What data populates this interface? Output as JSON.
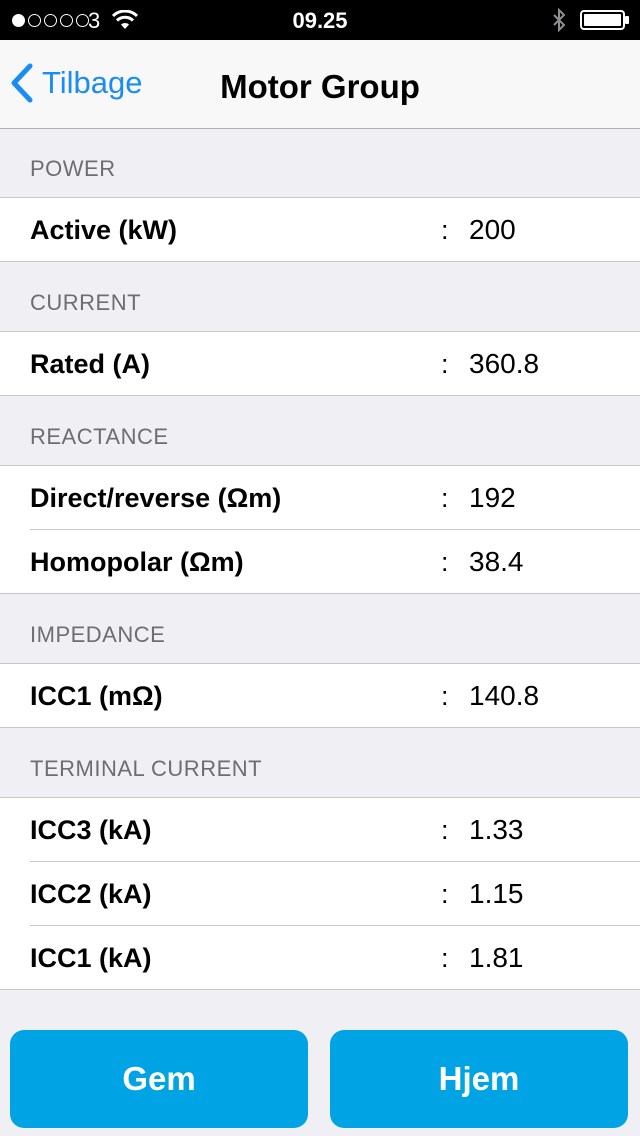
{
  "status_bar": {
    "carrier": "3",
    "time": "09.25",
    "signal_bars_filled": 1,
    "signal_bars_total": 5
  },
  "nav": {
    "back_label": "Tilbage",
    "title": "Motor Group"
  },
  "sections": [
    {
      "header": "POWER",
      "rows": [
        {
          "label": "Active (kW)",
          "colon": ":",
          "value": "200"
        }
      ]
    },
    {
      "header": "CURRENT",
      "rows": [
        {
          "label": "Rated (A)",
          "colon": ":",
          "value": "360.8"
        }
      ]
    },
    {
      "header": "REACTANCE",
      "rows": [
        {
          "label": "Direct/reverse (Ωm)",
          "colon": ":",
          "value": "192"
        },
        {
          "label": "Homopolar (Ωm)",
          "colon": ":",
          "value": "38.4"
        }
      ]
    },
    {
      "header": "IMPEDANCE",
      "rows": [
        {
          "label": "ICC1 (mΩ)",
          "colon": ":",
          "value": "140.8"
        }
      ]
    },
    {
      "header": "TERMINAL CURRENT",
      "rows": [
        {
          "label": "ICC3 (kA)",
          "colon": ":",
          "value": "1.33"
        },
        {
          "label": "ICC2 (kA)",
          "colon": ":",
          "value": "1.15"
        },
        {
          "label": "ICC1 (kA)",
          "colon": ":",
          "value": "1.81"
        }
      ]
    }
  ],
  "buttons": {
    "save_label": "Gem",
    "home_label": "Hjem"
  },
  "colors": {
    "accent": "#1a8cf5",
    "button": "#00a4e4",
    "background": "#efeff4"
  }
}
